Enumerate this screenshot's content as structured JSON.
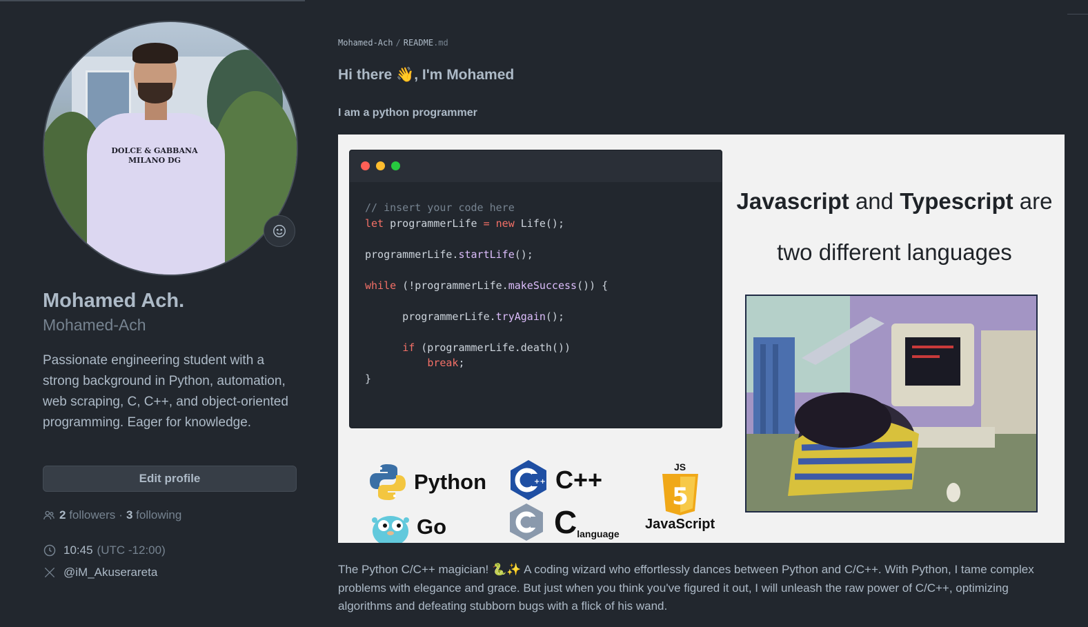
{
  "profile": {
    "full_name": "Mohamed Ach.",
    "login": "Mohamed-Ach",
    "bio": "Passionate engineering student with a strong background in Python, automation, web scraping, C, C++, and object-oriented programming. Eager for knowledge.",
    "edit_button": "Edit profile",
    "followers_count": "2",
    "followers_label": "followers",
    "following_count": "3",
    "following_label": "following",
    "follow_separator": "·",
    "local_time": "10:45",
    "timezone": "(UTC -12:00)",
    "twitter": "@iM_Akuserareta",
    "status_icon": "smiley-icon",
    "avatar_shirt_text": "DOLCE & GABBANA MILANO DG"
  },
  "readme": {
    "breadcrumb_owner": "Mohamed-Ach",
    "breadcrumb_separator": "/",
    "breadcrumb_file": "README",
    "breadcrumb_ext": ".md",
    "heading_before": "Hi there ",
    "heading_emoji": "👋",
    "heading_after": ", I'm Mohamed",
    "subheading": "I am a python programmer",
    "banner": {
      "code_comment": "// insert your code here",
      "js_word1": "Javascript",
      "js_and": " and ",
      "js_word2": "Typescript",
      "js_are": " are",
      "js_line2": "two different languages",
      "languages": {
        "python": "Python",
        "cpp": "C++",
        "javascript": "JavaScript",
        "go": "Go",
        "c": "C",
        "c_sub": "language",
        "js_badge": "JS"
      }
    },
    "paragraph_start": "The Python C/C++ magician! ",
    "paragraph_emoji": "🐍✨",
    "paragraph_end": " A coding wizard who effortlessly dances between Python and C/C++. With Python, I tame complex problems with elegance and grace. But just when you think you've figured it out, I will unleash the raw power of C/C++, optimizing algorithms and defeating stubborn bugs with a flick of his wand."
  },
  "colors": {
    "background": "#22272e",
    "text": "#adbac7",
    "muted": "#768390",
    "keyword": "#f47067",
    "function": "#dcbdfb"
  }
}
